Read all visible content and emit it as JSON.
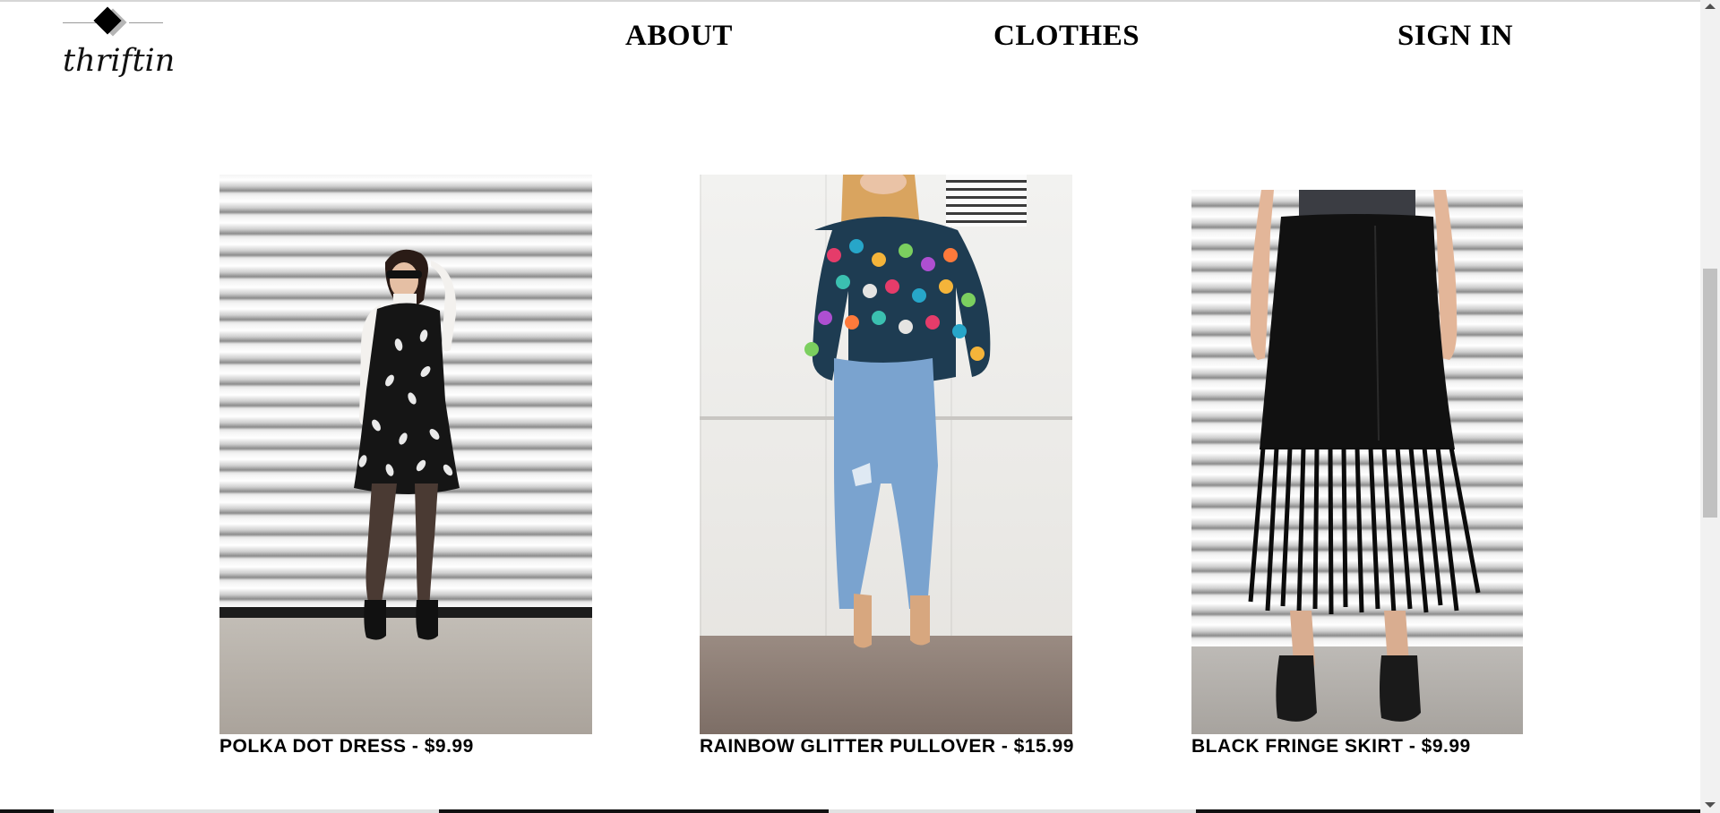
{
  "brand": {
    "name": "thriftin"
  },
  "nav": {
    "about": "ABOUT",
    "clothes": "CLOTHES",
    "sign_in": "SIGN IN"
  },
  "products": [
    {
      "name": "POLKA DOT DRESS",
      "price": "$9.99",
      "caption": "POLKA DOT DRESS - $9.99"
    },
    {
      "name": "RAINBOW GLITTER PULLOVER",
      "price": "$15.99",
      "caption": "RAINBOW GLITTER PULLOVER - $15.99"
    },
    {
      "name": "BLACK FRINGE SKIRT",
      "price": "$9.99",
      "caption": "BLACK FRINGE SKIRT - $9.99"
    }
  ],
  "colors": {
    "background": "#ffffff",
    "text": "#000000",
    "scrollbar_track": "#f1f1f1",
    "scrollbar_thumb": "#c1c1c1"
  },
  "icons": {
    "logo": "diamond-logo-icon",
    "scroll_up": "triangle-up-icon",
    "scroll_down": "triangle-down-icon"
  }
}
